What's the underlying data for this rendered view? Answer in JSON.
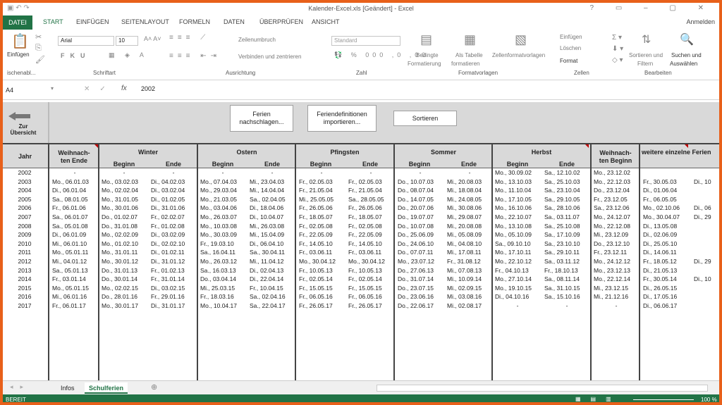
{
  "title": "Kalender-Excel.xls [Geändert] - Excel",
  "window_controls": "? ▭ – ▢ ✕",
  "tabs": [
    "DATEI",
    "START",
    "EINFÜGEN",
    "SEITENLAYOUT",
    "FORMELN",
    "DATEN",
    "ÜBERPRÜFEN",
    "ANSICHT"
  ],
  "signin": "Anmelden",
  "ribbon": {
    "paste": "Einfügen",
    "clipboard": "ischenabl...",
    "font": "Arial",
    "size": "10",
    "font_group": "Schriftart",
    "wrap": "Zeilenumbruch",
    "merge": "Verbinden und zentrieren",
    "align_group": "Ausrichtung",
    "numfmt": "Standard",
    "number_group": "Zahl",
    "cond1": "Bedingte",
    "cond2": "Formatierung",
    "astable1": "Als Tabelle",
    "astable2": "formatieren",
    "cellstyles": "Zellenformatvorlagen",
    "styles_group": "Formatvorlagen",
    "insert": "Einfügen",
    "delete": "Löschen",
    "format": "Format",
    "cells_group": "Zellen",
    "sort1": "Sortieren und",
    "sort2": "Filtern",
    "find1": "Suchen und",
    "find2": "Auswählen",
    "edit_group": "Bearbeiten"
  },
  "formula_bar": {
    "cell": "A4",
    "fx": "fx",
    "value": "2002"
  },
  "back_label_1": "Zur",
  "back_label_2": "Übersicht",
  "buttons": {
    "ferien_1": "Ferien",
    "ferien_2": "nachschlagen...",
    "import_1": "Feriendefinitionen",
    "import_2": "importieren...",
    "sort": "Sortieren"
  },
  "headers": {
    "jahr": "Jahr",
    "weih_e_1": "Weihnach-",
    "weih_e_2": "ten Ende",
    "winter": "Winter",
    "ostern": "Ostern",
    "pfingsten": "Pfingsten",
    "sommer": "Sommer",
    "herbst": "Herbst",
    "weih_b_1": "Weihnach-",
    "weih_b_2": "ten Beginn",
    "weitere": "weitere einzelne Ferien",
    "beginn": "Beginn",
    "ende": "Ende"
  },
  "rows": [
    {
      "y": "2002",
      "we": "-",
      "wb": "-",
      "wn": "-",
      "ob": "-",
      "oe": "-",
      "pb": "-",
      "pe": "-",
      "sb": "-",
      "se": "-",
      "hb": "Mo., 30.09.02",
      "he": "Sa., 12.10.02",
      "wbg": "Mo., 23.12.02",
      "x1": "",
      "x2": ""
    },
    {
      "y": "2003",
      "we": "Mo., 06.01.03",
      "wb": "Mo., 03.02.03",
      "wn": "Di., 04.02.03",
      "ob": "Mo., 07.04.03",
      "oe": "Mi., 23.04.03",
      "pb": "Fr., 02.05.03",
      "pe": "Fr., 02.05.03",
      "sb": "Do., 10.07.03",
      "se": "Mi., 20.08.03",
      "hb": "Mo., 13.10.03",
      "he": "Sa., 25.10.03",
      "wbg": "Mo., 22.12.03",
      "x1": "Fr., 30.05.03",
      "x2": "Di., 10"
    },
    {
      "y": "2004",
      "we": "Di., 06.01.04",
      "wb": "Mo., 02.02.04",
      "wn": "Di., 03.02.04",
      "ob": "Mo., 29.03.04",
      "oe": "Mi., 14.04.04",
      "pb": "Fr., 21.05.04",
      "pe": "Fr., 21.05.04",
      "sb": "Do., 08.07.04",
      "se": "Mi., 18.08.04",
      "hb": "Mo., 11.10.04",
      "he": "Sa., 23.10.04",
      "wbg": "Do., 23.12.04",
      "x1": "Di., 01.06.04",
      "x2": ""
    },
    {
      "y": "2005",
      "we": "Sa., 08.01.05",
      "wb": "Mo., 31.01.05",
      "wn": "Di., 01.02.05",
      "ob": "Mo., 21.03.05",
      "oe": "Sa., 02.04.05",
      "pb": "Mi., 25.05.05",
      "pe": "Sa., 28.05.05",
      "sb": "Do., 14.07.05",
      "se": "Mi., 24.08.05",
      "hb": "Mo., 17.10.05",
      "he": "Sa., 29.10.05",
      "wbg": "Fr., 23.12.05",
      "x1": "Fr., 06.05.05",
      "x2": ""
    },
    {
      "y": "2006",
      "we": "Fr., 06.01.06",
      "wb": "Mo., 30.01.06",
      "wn": "Di., 31.01.06",
      "ob": "Mo., 03.04.06",
      "oe": "Di., 18.04.06",
      "pb": "Fr., 26.05.06",
      "pe": "Fr., 26.05.06",
      "sb": "Do., 20.07.06",
      "se": "Mi., 30.08.06",
      "hb": "Mo., 16.10.06",
      "he": "Sa., 28.10.06",
      "wbg": "Sa., 23.12.06",
      "x1": "Mo., 02.10.06",
      "x2": "Di., 06"
    },
    {
      "y": "2007",
      "we": "Sa., 06.01.07",
      "wb": "Do., 01.02.07",
      "wn": "Fr., 02.02.07",
      "ob": "Mo., 26.03.07",
      "oe": "Di., 10.04.07",
      "pb": "Fr., 18.05.07",
      "pe": "Fr., 18.05.07",
      "sb": "Do., 19.07.07",
      "se": "Mi., 29.08.07",
      "hb": "Mo., 22.10.07",
      "he": "Sa., 03.11.07",
      "wbg": "Mo., 24.12.07",
      "x1": "Mo., 30.04.07",
      "x2": "Di., 29"
    },
    {
      "y": "2008",
      "we": "Sa., 05.01.08",
      "wb": "Do., 31.01.08",
      "wn": "Fr., 01.02.08",
      "ob": "Mo., 10.03.08",
      "oe": "Mi., 26.03.08",
      "pb": "Fr., 02.05.08",
      "pe": "Fr., 02.05.08",
      "sb": "Do., 10.07.08",
      "se": "Mi., 20.08.08",
      "hb": "Mo., 13.10.08",
      "he": "Sa., 25.10.08",
      "wbg": "Mo., 22.12.08",
      "x1": "Di., 13.05.08",
      "x2": ""
    },
    {
      "y": "2009",
      "we": "Di., 06.01.09",
      "wb": "Mo., 02.02.09",
      "wn": "Di., 03.02.09",
      "ob": "Mo., 30.03.09",
      "oe": "Mi., 15.04.09",
      "pb": "Fr., 22.05.09",
      "pe": "Fr., 22.05.09",
      "sb": "Do., 25.06.09",
      "se": "Mi., 05.08.09",
      "hb": "Mo., 05.10.09",
      "he": "Sa., 17.10.09",
      "wbg": "Mi., 23.12.09",
      "x1": "Di., 02.06.09",
      "x2": ""
    },
    {
      "y": "2010",
      "we": "Mi., 06.01.10",
      "wb": "Mo., 01.02.10",
      "wn": "Di., 02.02.10",
      "ob": "Fr., 19.03.10",
      "oe": "Di., 06.04.10",
      "pb": "Fr., 14.05.10",
      "pe": "Fr., 14.05.10",
      "sb": "Do., 24.06.10",
      "se": "Mi., 04.08.10",
      "hb": "Sa., 09.10.10",
      "he": "Sa., 23.10.10",
      "wbg": "Do., 23.12.10",
      "x1": "Di., 25.05.10",
      "x2": ""
    },
    {
      "y": "2011",
      "we": "Mo., 05.01.11",
      "wb": "Mo., 31.01.11",
      "wn": "Di., 01.02.11",
      "ob": "Sa., 16.04.11",
      "oe": "Sa., 30.04.11",
      "pb": "Fr., 03.06.11",
      "pe": "Fr., 03.06.11",
      "sb": "Do., 07.07.11",
      "se": "Mi., 17.08.11",
      "hb": "Mo., 17.10.11",
      "he": "Sa., 29.10.11",
      "wbg": "Fr., 23.12.11",
      "x1": "Di., 14.06.11",
      "x2": ""
    },
    {
      "y": "2012",
      "we": "Mi., 04.01.12",
      "wb": "Mo., 30.01.12",
      "wn": "Di., 31.01.12",
      "ob": "Mo., 26.03.12",
      "oe": "Mi., 11.04.12",
      "pb": "Mo., 30.04.12",
      "pe": "Mo., 30.04.12",
      "sb": "Mo., 23.07.12",
      "se": "Fr., 31.08.12",
      "hb": "Mo., 22.10.12",
      "he": "Sa., 03.11.12",
      "wbg": "Mo., 24.12.12",
      "x1": "Fr., 18.05.12",
      "x2": "Di., 29"
    },
    {
      "y": "2013",
      "we": "Sa., 05.01.13",
      "wb": "Do., 31.01.13",
      "wn": "Fr., 01.02.13",
      "ob": "Sa., 16.03.13",
      "oe": "Di., 02.04.13",
      "pb": "Fr., 10.05.13",
      "pe": "Fr., 10.05.13",
      "sb": "Do., 27.06.13",
      "se": "Mi., 07.08.13",
      "hb": "Fr., 04.10.13",
      "he": "Fr., 18.10.13",
      "wbg": "Mo., 23.12.13",
      "x1": "Di., 21.05.13",
      "x2": ""
    },
    {
      "y": "2014",
      "we": "Fr., 03.01.14",
      "wb": "Do., 30.01.14",
      "wn": "Fr., 31.01.14",
      "ob": "Do., 03.04.14",
      "oe": "Di., 22.04.14",
      "pb": "Fr., 02.05.14",
      "pe": "Fr., 02.05.14",
      "sb": "Do., 31.07.14",
      "se": "Mi., 10.09.14",
      "hb": "Mo., 27.10.14",
      "he": "Sa., 08.11.14",
      "wbg": "Mo., 22.12.14",
      "x1": "Fr., 30.05.14",
      "x2": "Di., 10"
    },
    {
      "y": "2015",
      "we": "Mo., 05.01.15",
      "wb": "Mo., 02.02.15",
      "wn": "Di., 03.02.15",
      "ob": "Mi., 25.03.15",
      "oe": "Fr., 10.04.15",
      "pb": "Fr., 15.05.15",
      "pe": "Fr., 15.05.15",
      "sb": "Do., 23.07.15",
      "se": "Mi., 02.09.15",
      "hb": "Mo., 19.10.15",
      "he": "Sa., 31.10.15",
      "wbg": "Mi., 23.12.15",
      "x1": "Di., 26.05.15",
      "x2": ""
    },
    {
      "y": "2016",
      "we": "Mi., 06.01.16",
      "wb": "Do., 28.01.16",
      "wn": "Fr., 29.01.16",
      "ob": "Fr., 18.03.16",
      "oe": "Sa., 02.04.16",
      "pb": "Fr., 06.05.16",
      "pe": "Fr., 06.05.16",
      "sb": "Do., 23.06.16",
      "se": "Mi., 03.08.16",
      "hb": "Di., 04.10.16",
      "he": "Sa., 15.10.16",
      "wbg": "Mi., 21.12.16",
      "x1": "Di., 17.05.16",
      "x2": ""
    },
    {
      "y": "2017",
      "we": "Fr., 06.01.17",
      "wb": "Mo., 30.01.17",
      "wn": "Di., 31.01.17",
      "ob": "Mo., 10.04.17",
      "oe": "Sa., 22.04.17",
      "pb": "Fr., 26.05.17",
      "pe": "Fr., 26.05.17",
      "sb": "Do., 22.06.17",
      "se": "Mi., 02.08.17",
      "hb": "-",
      "he": "-",
      "wbg": "-",
      "x1": "Di., 06.06.17",
      "x2": ""
    }
  ],
  "sheet_tabs": [
    "Infos",
    "Schulferien"
  ],
  "status": {
    "ready": "BEREIT",
    "zoom": "100 %"
  },
  "colors": {
    "excel_green": "#217346",
    "frame_orange": "#e8601a"
  }
}
